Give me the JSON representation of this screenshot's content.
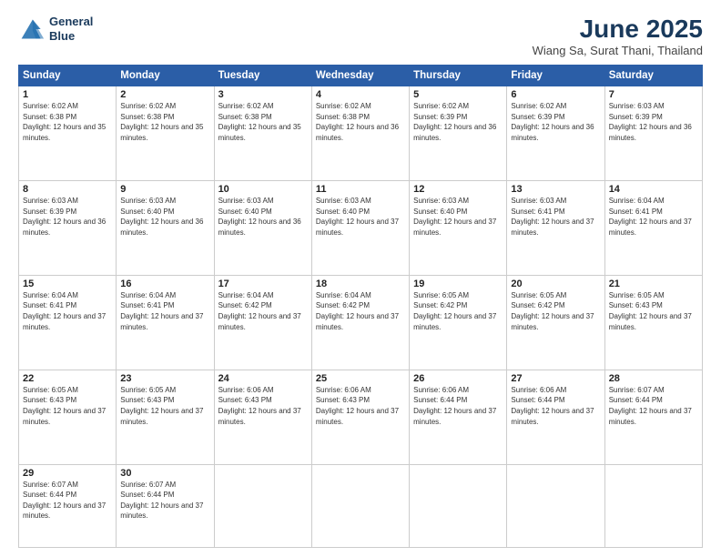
{
  "header": {
    "logo_line1": "General",
    "logo_line2": "Blue",
    "month": "June 2025",
    "location": "Wiang Sa, Surat Thani, Thailand"
  },
  "weekdays": [
    "Sunday",
    "Monday",
    "Tuesday",
    "Wednesday",
    "Thursday",
    "Friday",
    "Saturday"
  ],
  "weeks": [
    [
      {
        "day": "1",
        "sunrise": "6:02 AM",
        "sunset": "6:38 PM",
        "daylight": "12 hours and 35 minutes."
      },
      {
        "day": "2",
        "sunrise": "6:02 AM",
        "sunset": "6:38 PM",
        "daylight": "12 hours and 35 minutes."
      },
      {
        "day": "3",
        "sunrise": "6:02 AM",
        "sunset": "6:38 PM",
        "daylight": "12 hours and 35 minutes."
      },
      {
        "day": "4",
        "sunrise": "6:02 AM",
        "sunset": "6:38 PM",
        "daylight": "12 hours and 36 minutes."
      },
      {
        "day": "5",
        "sunrise": "6:02 AM",
        "sunset": "6:39 PM",
        "daylight": "12 hours and 36 minutes."
      },
      {
        "day": "6",
        "sunrise": "6:02 AM",
        "sunset": "6:39 PM",
        "daylight": "12 hours and 36 minutes."
      },
      {
        "day": "7",
        "sunrise": "6:03 AM",
        "sunset": "6:39 PM",
        "daylight": "12 hours and 36 minutes."
      }
    ],
    [
      {
        "day": "8",
        "sunrise": "6:03 AM",
        "sunset": "6:39 PM",
        "daylight": "12 hours and 36 minutes."
      },
      {
        "day": "9",
        "sunrise": "6:03 AM",
        "sunset": "6:40 PM",
        "daylight": "12 hours and 36 minutes."
      },
      {
        "day": "10",
        "sunrise": "6:03 AM",
        "sunset": "6:40 PM",
        "daylight": "12 hours and 36 minutes."
      },
      {
        "day": "11",
        "sunrise": "6:03 AM",
        "sunset": "6:40 PM",
        "daylight": "12 hours and 37 minutes."
      },
      {
        "day": "12",
        "sunrise": "6:03 AM",
        "sunset": "6:40 PM",
        "daylight": "12 hours and 37 minutes."
      },
      {
        "day": "13",
        "sunrise": "6:03 AM",
        "sunset": "6:41 PM",
        "daylight": "12 hours and 37 minutes."
      },
      {
        "day": "14",
        "sunrise": "6:04 AM",
        "sunset": "6:41 PM",
        "daylight": "12 hours and 37 minutes."
      }
    ],
    [
      {
        "day": "15",
        "sunrise": "6:04 AM",
        "sunset": "6:41 PM",
        "daylight": "12 hours and 37 minutes."
      },
      {
        "day": "16",
        "sunrise": "6:04 AM",
        "sunset": "6:41 PM",
        "daylight": "12 hours and 37 minutes."
      },
      {
        "day": "17",
        "sunrise": "6:04 AM",
        "sunset": "6:42 PM",
        "daylight": "12 hours and 37 minutes."
      },
      {
        "day": "18",
        "sunrise": "6:04 AM",
        "sunset": "6:42 PM",
        "daylight": "12 hours and 37 minutes."
      },
      {
        "day": "19",
        "sunrise": "6:05 AM",
        "sunset": "6:42 PM",
        "daylight": "12 hours and 37 minutes."
      },
      {
        "day": "20",
        "sunrise": "6:05 AM",
        "sunset": "6:42 PM",
        "daylight": "12 hours and 37 minutes."
      },
      {
        "day": "21",
        "sunrise": "6:05 AM",
        "sunset": "6:43 PM",
        "daylight": "12 hours and 37 minutes."
      }
    ],
    [
      {
        "day": "22",
        "sunrise": "6:05 AM",
        "sunset": "6:43 PM",
        "daylight": "12 hours and 37 minutes."
      },
      {
        "day": "23",
        "sunrise": "6:05 AM",
        "sunset": "6:43 PM",
        "daylight": "12 hours and 37 minutes."
      },
      {
        "day": "24",
        "sunrise": "6:06 AM",
        "sunset": "6:43 PM",
        "daylight": "12 hours and 37 minutes."
      },
      {
        "day": "25",
        "sunrise": "6:06 AM",
        "sunset": "6:43 PM",
        "daylight": "12 hours and 37 minutes."
      },
      {
        "day": "26",
        "sunrise": "6:06 AM",
        "sunset": "6:44 PM",
        "daylight": "12 hours and 37 minutes."
      },
      {
        "day": "27",
        "sunrise": "6:06 AM",
        "sunset": "6:44 PM",
        "daylight": "12 hours and 37 minutes."
      },
      {
        "day": "28",
        "sunrise": "6:07 AM",
        "sunset": "6:44 PM",
        "daylight": "12 hours and 37 minutes."
      }
    ],
    [
      {
        "day": "29",
        "sunrise": "6:07 AM",
        "sunset": "6:44 PM",
        "daylight": "12 hours and 37 minutes."
      },
      {
        "day": "30",
        "sunrise": "6:07 AM",
        "sunset": "6:44 PM",
        "daylight": "12 hours and 37 minutes."
      },
      null,
      null,
      null,
      null,
      null
    ]
  ]
}
